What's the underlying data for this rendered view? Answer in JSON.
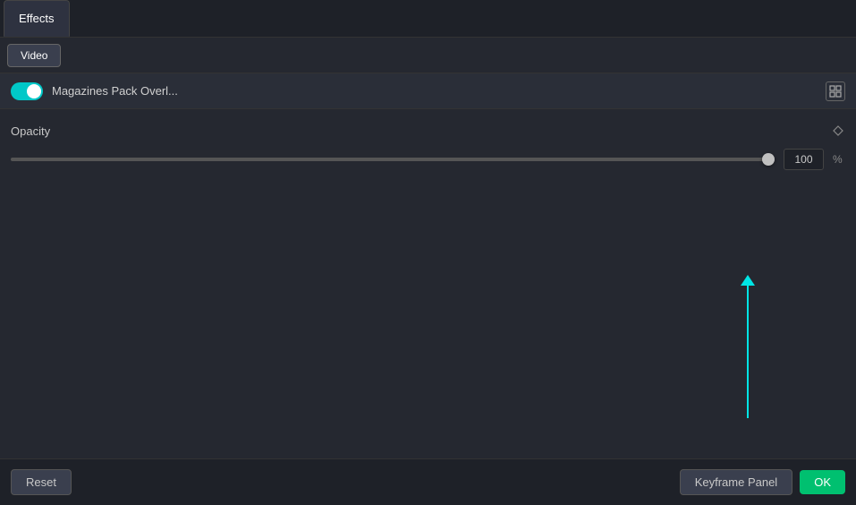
{
  "tabs": {
    "primary": [
      {
        "id": "effects",
        "label": "Effects",
        "active": true
      }
    ],
    "secondary": [
      {
        "id": "video",
        "label": "Video",
        "active": true
      }
    ]
  },
  "effect": {
    "enabled": true,
    "name": "Magazines Pack Overl...",
    "icon_label": "⊡"
  },
  "opacity": {
    "label": "Opacity",
    "value": 100,
    "unit": "%",
    "slider_percent": 99
  },
  "bottom_bar": {
    "reset_label": "Reset",
    "keyframe_panel_label": "Keyframe Panel",
    "ok_label": "OK"
  },
  "colors": {
    "accent": "#00c8c8",
    "ok_green": "#00c070",
    "background": "#252830",
    "surface": "#2a2e38",
    "dark": "#1e2128"
  }
}
